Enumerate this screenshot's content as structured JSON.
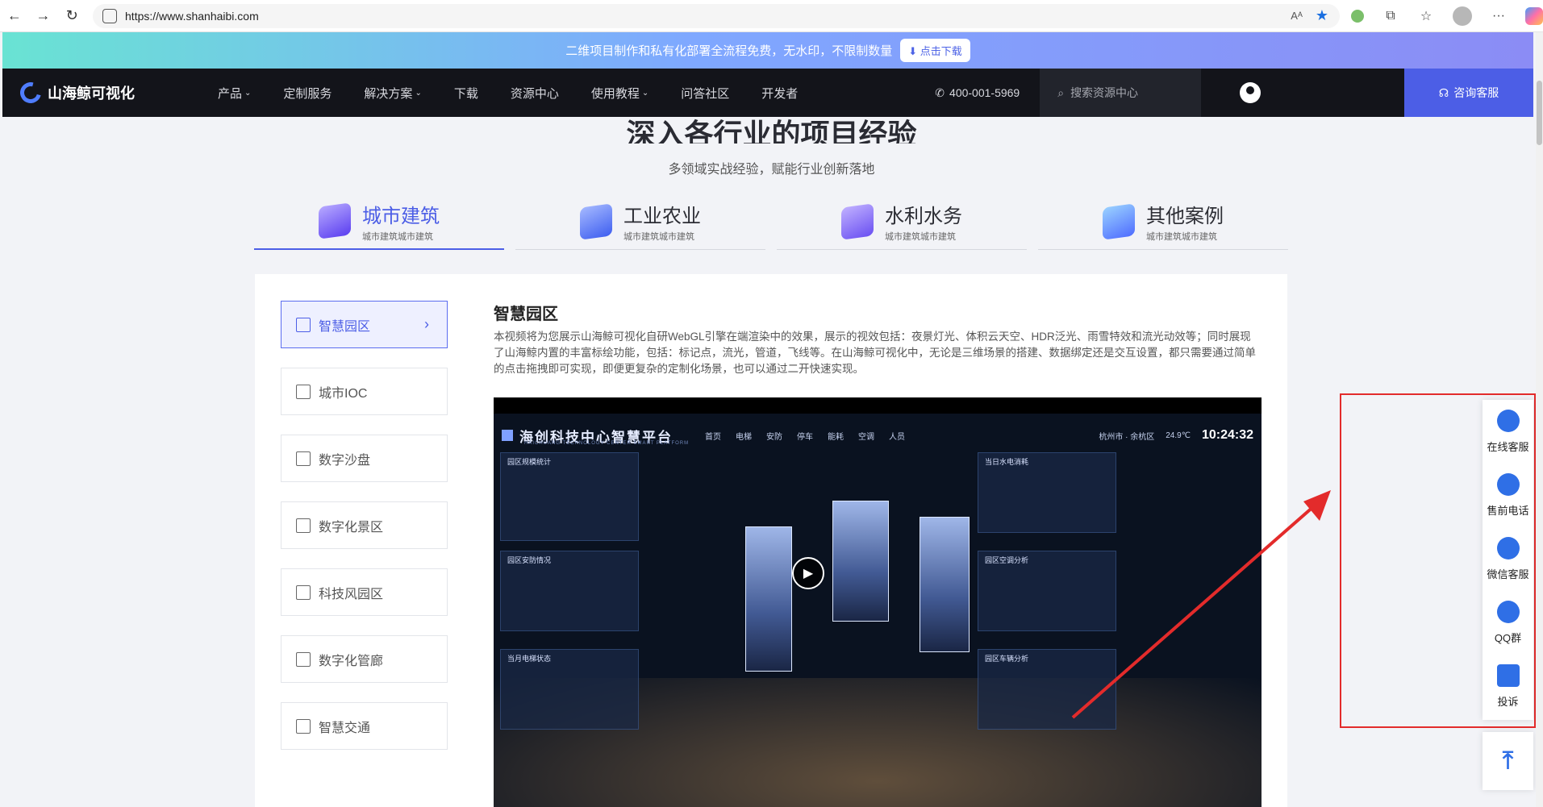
{
  "browser": {
    "url": "https://www.shanhaibi.com",
    "read_aloud": "Aᴬ",
    "more": "···"
  },
  "promo": {
    "text": "二维项目制作和私有化部署全流程免费，无水印，不限制数量",
    "button": "点击下载"
  },
  "header": {
    "logo": "山海鲸可视化",
    "menu": [
      {
        "label": "产品",
        "dropdown": true
      },
      {
        "label": "定制服务",
        "dropdown": false
      },
      {
        "label": "解决方案",
        "dropdown": true
      },
      {
        "label": "下载",
        "dropdown": false
      },
      {
        "label": "资源中心",
        "dropdown": false
      },
      {
        "label": "使用教程",
        "dropdown": true
      },
      {
        "label": "问答社区",
        "dropdown": false
      },
      {
        "label": "开发者",
        "dropdown": false
      }
    ],
    "phone": "400-001-5969",
    "search_placeholder": "搜索资源中心",
    "consult": "咨询客服"
  },
  "section": {
    "title": "深入各行业的项目经验",
    "subtitle": "多领域实战经验，赋能行业创新落地"
  },
  "tabs": [
    {
      "name": "城市建筑",
      "desc": "城市建筑城市建筑",
      "active": true
    },
    {
      "name": "工业农业",
      "desc": "城市建筑城市建筑",
      "active": false
    },
    {
      "name": "水利水务",
      "desc": "城市建筑城市建筑",
      "active": false
    },
    {
      "name": "其他案例",
      "desc": "城市建筑城市建筑",
      "active": false
    }
  ],
  "sidebar": {
    "items": [
      {
        "label": "智慧园区",
        "active": true
      },
      {
        "label": "城市IOC",
        "active": false
      },
      {
        "label": "数字沙盘",
        "active": false
      },
      {
        "label": "数字化景区",
        "active": false
      },
      {
        "label": "科技风园区",
        "active": false
      },
      {
        "label": "数字化管廊",
        "active": false
      },
      {
        "label": "智慧交通",
        "active": false
      }
    ]
  },
  "detail": {
    "title": "智慧园区",
    "text": "本视频将为您展示山海鲸可视化自研WebGL引擎在端渲染中的效果，展示的视效包括：夜景灯光、体积云天空、HDR泛光、雨雪特效和流光动效等；同时展现了山海鲸内置的丰富标绘功能，包括：标记点，流光，管道，飞线等。在山海鲸可视化中，无论是三维场景的搭建、数据绑定还是交互设置，都只需要通过简单的点击拖拽即可实现，即便更复杂的定制化场景，也可以通过二开快速实现。"
  },
  "video": {
    "title": "海创科技中心智慧平台",
    "subtitle": "HAICHUANG TECHNOLOGY CENTER SMART PLATFORM",
    "nav": [
      "首页",
      "电梯",
      "安防",
      "停车",
      "能耗",
      "空调",
      "人员"
    ],
    "city": "杭州市 · 余杭区",
    "temp": "24.9℃",
    "time": "10:24:32",
    "panels": [
      "园区规模统计",
      "园区安防情况",
      "当月电梯状态",
      "当日水电消耗",
      "园区空调分析",
      "园区车辆分析"
    ]
  },
  "float_bar": [
    {
      "label": "在线客服",
      "icon": "headset-icon"
    },
    {
      "label": "售前电话",
      "icon": "phone-icon"
    },
    {
      "label": "微信客服",
      "icon": "wechat-icon"
    },
    {
      "label": "QQ群",
      "icon": "qq-icon"
    },
    {
      "label": "投诉",
      "icon": "complaint-icon"
    }
  ],
  "colors": {
    "accent": "#4c5ee6",
    "header_bg": "#13141a",
    "annotation": "#e32b2b",
    "float_icon": "#2f6fe6"
  }
}
